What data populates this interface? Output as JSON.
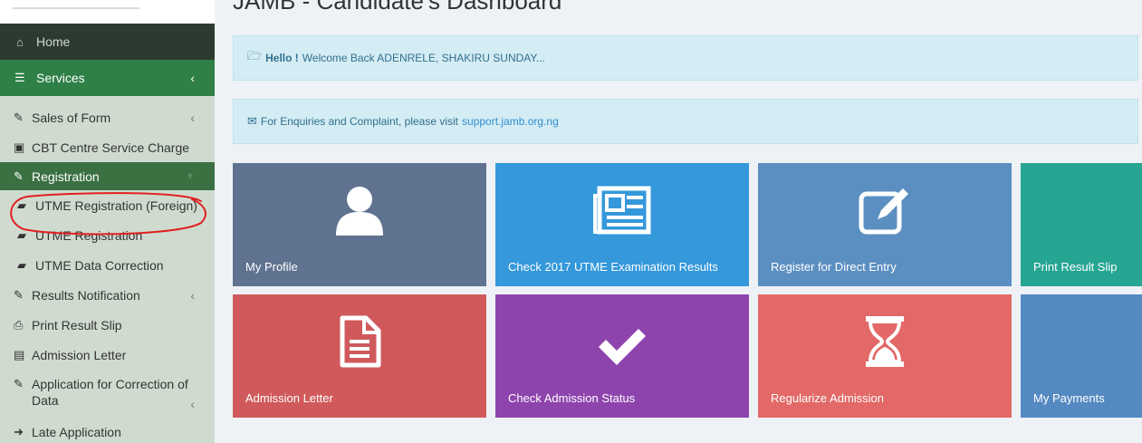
{
  "page": {
    "title": "JAMB - Candidate's Dashboard"
  },
  "sidebar": {
    "home": "Home",
    "services": "Services",
    "items": [
      {
        "label": "Sales of Form"
      },
      {
        "label": "CBT Centre Service Charge"
      },
      {
        "label": "Registration"
      },
      {
        "label": "UTME Registration (Foreign)"
      },
      {
        "label": "UTME Registration"
      },
      {
        "label": "UTME Data Correction"
      },
      {
        "label": "Results Notification"
      },
      {
        "label": "Print Result Slip"
      },
      {
        "label": "Admission Letter"
      },
      {
        "label": "Application for Correction of Data"
      },
      {
        "label": "Late Application"
      }
    ]
  },
  "alerts": {
    "welcome": {
      "bold": "Hello !",
      "text": "Welcome Back ADENRELE, SHAKIRU SUNDAY..."
    },
    "enquiry": {
      "text": "For Enquiries and Complaint, please visit",
      "link": "support.jamb.org.ng"
    }
  },
  "tiles": [
    {
      "label": "My Profile",
      "icon": "user-icon",
      "color": "#5f7390"
    },
    {
      "label": "Check 2017 UTME Examination Results",
      "icon": "newspaper-icon",
      "color": "#3498db"
    },
    {
      "label": "Register for Direct Entry",
      "icon": "edit-icon",
      "color": "#5b8fc1"
    },
    {
      "label": "Print Result Slip",
      "icon": "print-icon",
      "color": "#25a592"
    },
    {
      "label": "Admission Letter",
      "icon": "document-icon",
      "color": "#d05a5b"
    },
    {
      "label": "Check Admission Status",
      "icon": "check-icon",
      "color": "#8e44ad"
    },
    {
      "label": "Regularize Admission",
      "icon": "hourglass-icon",
      "color": "#e26967"
    },
    {
      "label": "My Payments",
      "icon": "payment-icon",
      "color": "#5589c1"
    }
  ],
  "colors": {
    "home_bg": "#2d3a30",
    "services_bg": "#2e8046",
    "registration_bg": "#3a7042",
    "annotation": "#e02020"
  }
}
